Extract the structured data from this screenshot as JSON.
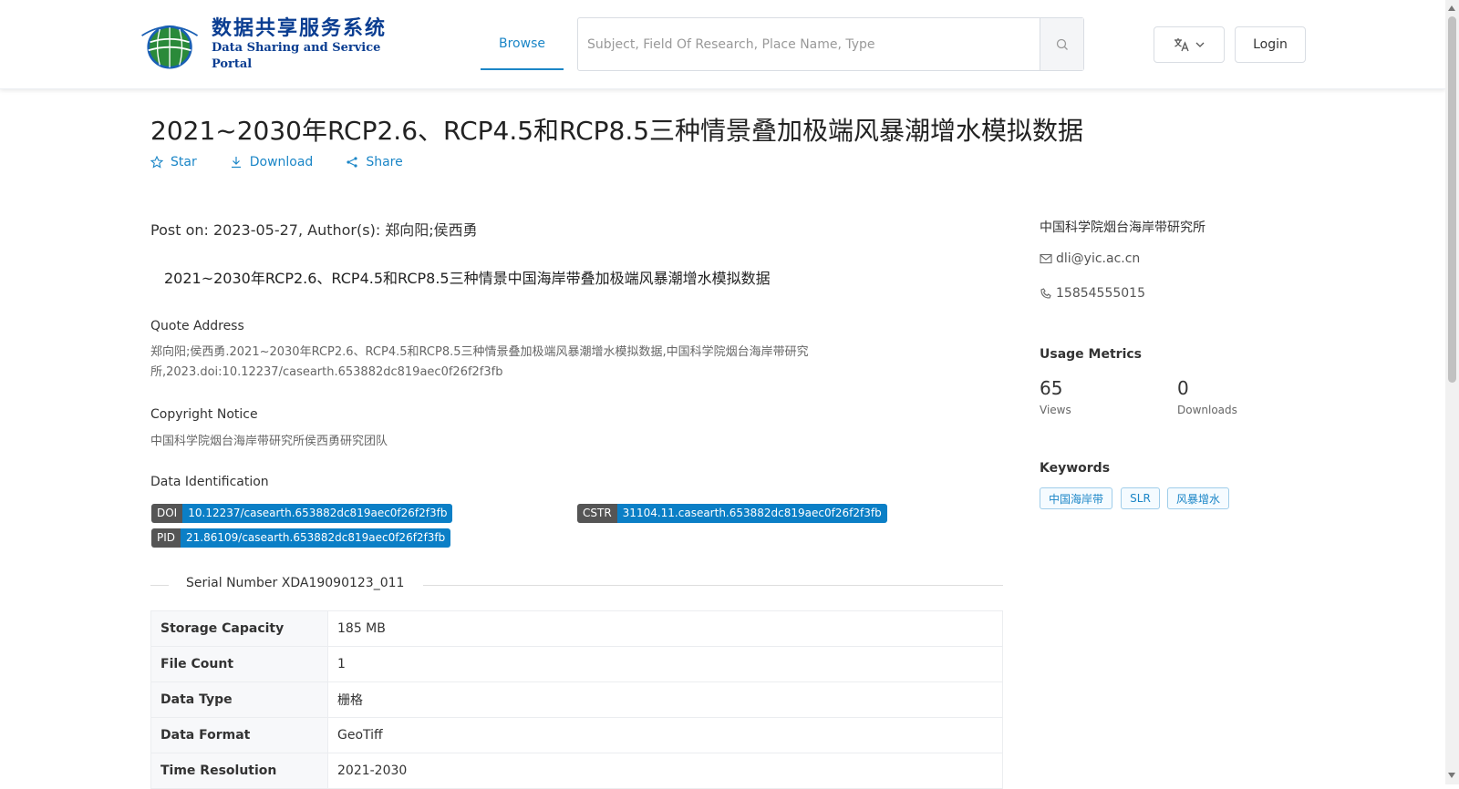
{
  "header": {
    "logo_cn": "数据共享服务系统",
    "logo_en": "Data Sharing and Service Portal",
    "nav_browse": "Browse",
    "search_placeholder": "Subject, Field Of Research, Place Name, Type",
    "login": "Login"
  },
  "dataset": {
    "title": "2021~2030年RCP2.6、RCP4.5和RCP8.5三种情景叠加极端风暴潮增水模拟数据",
    "actions": {
      "star": "Star",
      "download": "Download",
      "share": "Share"
    },
    "post_on": "Post on: 2023-05-27, Author(s): 郑向阳;侯西勇",
    "summary": "2021~2030年RCP2.6、RCP4.5和RCP8.5三种情景中国海岸带叠加极端风暴潮增水模拟数据",
    "quote_label": "Quote Address",
    "quote_line1": "郑向阳;侯西勇.2021~2030年RCP2.6、RCP4.5和RCP8.5三种情景叠加极端风暴潮增水模拟数据,中国科学院烟台海岸带研究",
    "quote_line2": "所,2023.doi:10.12237/casearth.653882dc819aec0f26f2f3fb",
    "copyright_label": "Copyright Notice",
    "copyright_text": "中国科学院烟台海岸带研究所侯西勇研究团队",
    "identification_label": "Data Identification",
    "identifiers": {
      "doi_key": "DOI",
      "doi_value": "10.12237/casearth.653882dc819aec0f26f2f3fb",
      "cstr_key": "CSTR",
      "cstr_value": "31104.11.casearth.653882dc819aec0f26f2f3fb",
      "pid_key": "PID",
      "pid_value": "21.86109/casearth.653882dc819aec0f26f2f3fb"
    },
    "serial": "Serial Number XDA19090123_011",
    "table": [
      {
        "key": "Storage Capacity",
        "value": "185 MB"
      },
      {
        "key": "File Count",
        "value": "1"
      },
      {
        "key": "Data Type",
        "value": "栅格"
      },
      {
        "key": "Data Format",
        "value": "GeoTiff"
      },
      {
        "key": "Time Resolution",
        "value": "2021-2030"
      }
    ]
  },
  "sidebar": {
    "org": "中国科学院烟台海岸带研究所",
    "email": "dli@yic.ac.cn",
    "phone": "15854555015",
    "metrics_label": "Usage Metrics",
    "views_value": "65",
    "views_label": "Views",
    "downloads_value": "0",
    "downloads_label": "Downloads",
    "keywords_label": "Keywords",
    "keywords": [
      "中国海岸带",
      "SLR",
      "风暴增水"
    ]
  },
  "colors": {
    "accent": "#1b86c7",
    "badge_key": "#555555",
    "badge_value": "#0b7fc6"
  }
}
